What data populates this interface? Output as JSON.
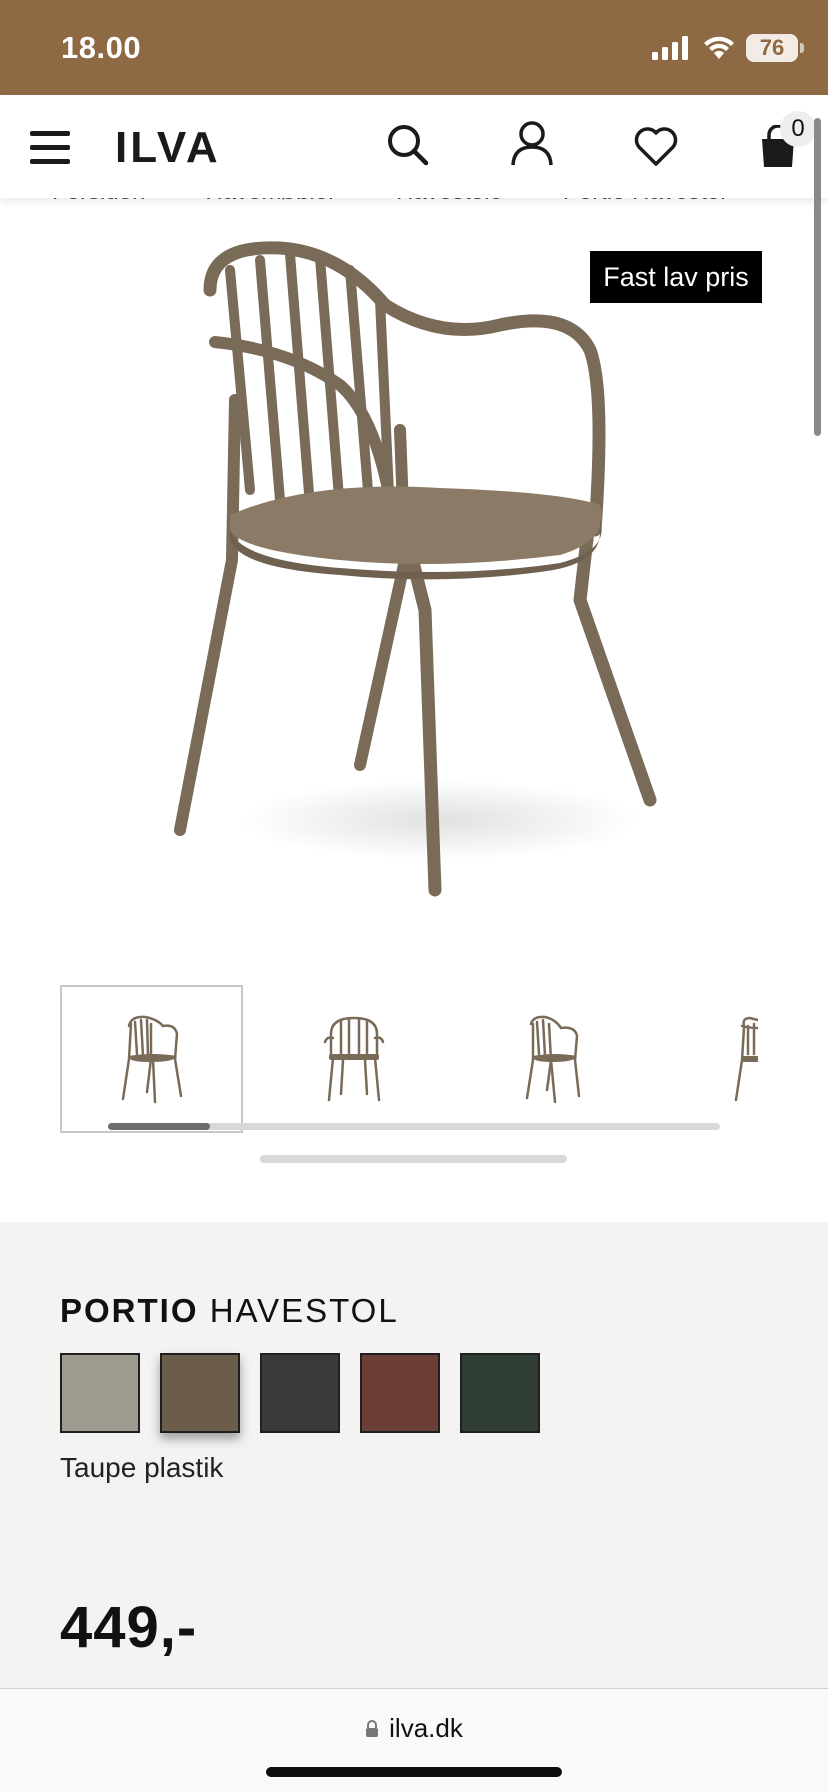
{
  "status_bar": {
    "time": "18.00",
    "battery": "76",
    "bg_color": "#8e6a44",
    "icons": [
      "signal-icon",
      "wifi-icon",
      "battery-icon"
    ]
  },
  "header": {
    "logo": "ILVA",
    "icons": [
      "menu-icon",
      "search-icon",
      "account-icon",
      "heart-icon",
      "bag-icon"
    ],
    "cart_count": "0"
  },
  "breadcrumb": [
    "Forsiden",
    "Havemøbler",
    "Havestole",
    "Portio Havestol"
  ],
  "breadcrumb_separator": "›",
  "badge": "Fast lav pris",
  "gallery": {
    "thumbnail_count": 4,
    "active_index": 0
  },
  "product": {
    "title_bold": "PORTIO",
    "title_rest": "HAVESTOL",
    "swatches": [
      {
        "color": "#9d9b8f",
        "selected": false
      },
      {
        "color": "#6b5c4b",
        "selected": true
      },
      {
        "color": "#3b3a3a",
        "selected": false
      },
      {
        "color": "#6b3f37",
        "selected": false
      },
      {
        "color": "#2f3d35",
        "selected": false
      }
    ],
    "variant": "Taupe plastik",
    "price": "449,-"
  },
  "url_bar": {
    "url": "ilva.dk",
    "icon": "lock-icon"
  }
}
